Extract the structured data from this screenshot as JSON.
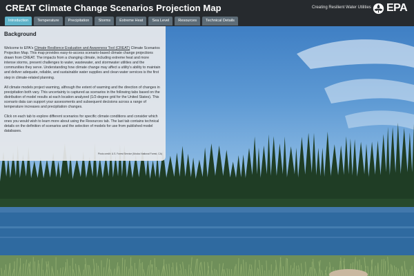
{
  "header": {
    "title": "CREAT Climate Change Scenarios Projection Map",
    "tagline": "Creating Resilient Water Utilities",
    "logo_text": "EPA",
    "logo_icon": "epa-flower-icon"
  },
  "tabs": [
    {
      "label": "Introduction",
      "active": true
    },
    {
      "label": "Temperature",
      "active": false
    },
    {
      "label": "Precipitation",
      "active": false
    },
    {
      "label": "Storms",
      "active": false
    },
    {
      "label": "Extreme Heat",
      "active": false
    },
    {
      "label": "Sea Level",
      "active": false
    },
    {
      "label": "Resources",
      "active": false
    },
    {
      "label": "Technical Details",
      "active": false
    }
  ],
  "panel": {
    "title": "Background",
    "p1_prefix": "Welcome to EPA's ",
    "p1_link": "Climate Resilience Evaluation and Awareness Tool (CREAT)",
    "p1_suffix": " Climate Scenarios Projection Map. This map provides easy-to-access scenario-based climate change projections drawn from CREAT. The impacts from a changing climate, including extreme heat and more intense storms, present challenges to water, wastewater, and stormwater utilities and the communities they serve. Understanding how climate change may affect a utility's ability to maintain and deliver adequate, reliable, and sustainable water supplies and clean water services is the first step in climate-related planning.",
    "p2": "All climate models project warming, although the extent of warming and the direction of changes in precipitation both vary. This uncertainty is captured as scenarios in the following tabs based on the distribution of model results at each location analyzed (1/2-degree grid for the United States). This scenario data can support your assessments and subsequent decisions across a range of temperature increases and precipitation changes.",
    "p3": "Click on each tab to explore different scenarios for specific climate conditions and consider which ones you would wish to learn more about using the Resources tab. The last tab contains technical details on the definition of scenarios and the selection of models for use from published model databases.",
    "credit": "Photo credit: U.S. Forest Service (Modoc National Forest, CA)"
  },
  "colors": {
    "header_bg": "#262a2e",
    "tab_bg": "#5d6c77",
    "tab_active_bg": "#5fb3c9",
    "panel_bg": "#e8eaec"
  }
}
